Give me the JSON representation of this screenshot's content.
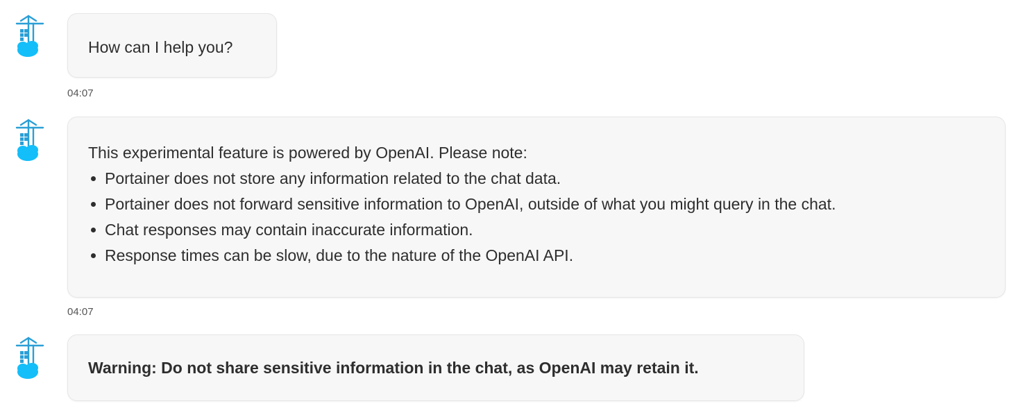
{
  "messages": [
    {
      "text": "How can I help you?",
      "time": "04:07"
    },
    {
      "intro": "This experimental feature is powered by OpenAI. Please note:",
      "notes": [
        "Portainer does not store any information related to the chat data.",
        "Portainer does not forward sensitive information to OpenAI, outside of what you might query in the chat.",
        "Chat responses may contain inaccurate information.",
        "Response times can be slow, due to the nature of the OpenAI API."
      ],
      "time": "04:07"
    },
    {
      "text": "Warning: Do not share sensitive information in the chat, as OpenAI may retain it."
    }
  ],
  "avatar": {
    "icon": "portainer-logo-icon",
    "color": "#13BEF9"
  }
}
